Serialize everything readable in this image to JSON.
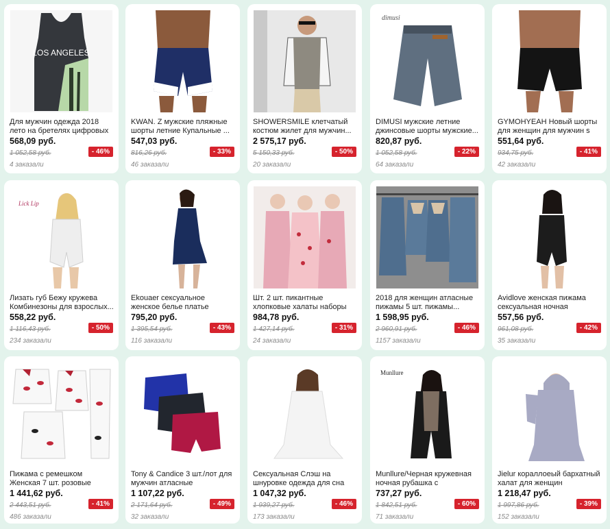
{
  "colors": {
    "background": "#e3f3ec",
    "discount_badge": "#d6232d",
    "card": "#ffffff"
  },
  "products": [
    {
      "title": "Для мужчин одежда 2018 лето на бретелях цифровых жилет ...",
      "price": "568,09 руб.",
      "old_price": "1 052,58 руб.",
      "discount": "- 46%",
      "orders": "4 заказали",
      "image_icon": "tank-top-image",
      "image_text": "LOS ANGELES"
    },
    {
      "title": "KWAN. Z мужские пляжные шорты летние Купальные ...",
      "price": "547,03 руб.",
      "old_price": "816,26 руб.",
      "discount": "- 33%",
      "orders": "46 заказали",
      "image_icon": "beach-shorts-image",
      "image_text": ""
    },
    {
      "title": "SHOWERSMILE клетчатый костюм жилет для мужчин...",
      "price": "2 575,17 руб.",
      "old_price": "5 150,33 руб.",
      "discount": "- 50%",
      "orders": "20 заказали",
      "image_icon": "vest-suit-image",
      "image_text": ""
    },
    {
      "title": "DIMUSI мужские летние джинсовые шорты мужские...",
      "price": "820,87 руб.",
      "old_price": "1 052,58 руб.",
      "discount": "- 22%",
      "orders": "64 заказали",
      "image_icon": "denim-shorts-image",
      "image_text": "dimusi"
    },
    {
      "title": "GYMOHYEAH Новый шорты для женщин для мужчин s Край ...",
      "price": "551,64 руб.",
      "old_price": "934,75 руб.",
      "discount": "- 41%",
      "orders": "42 заказали",
      "image_icon": "black-shorts-image",
      "image_text": ""
    },
    {
      "title": "Лизать губ Бежу кружева Комбинезоны для взрослых...",
      "price": "558,22 руб.",
      "old_price": "1 116,43 руб.",
      "discount": "- 50%",
      "orders": "234 заказали",
      "image_icon": "white-romper-image",
      "image_text": "Lick Lip"
    },
    {
      "title": "Ekouaer сексуальное женское белье платье пижамы для...",
      "price": "795,20 руб.",
      "old_price": "1 395,54 руб.",
      "discount": "- 43%",
      "orders": "116 заказали",
      "image_icon": "navy-nightdress-image",
      "image_text": ""
    },
    {
      "title": "Шт. 2 шт. пикантные хлопковые халаты наборы дл...",
      "price": "984,78 руб.",
      "old_price": "1 427,14 руб.",
      "discount": "- 31%",
      "orders": "24 заказали",
      "image_icon": "pink-robes-image",
      "image_text": ""
    },
    {
      "title": "2018 для женщин атласные пижамы 5 шт. пижамы...",
      "price": "1 598,95 руб.",
      "old_price": "2 960,91 руб.",
      "discount": "- 46%",
      "orders": "1157 заказали",
      "image_icon": "satin-pajama-set-image",
      "image_text": ""
    },
    {
      "title": "Avidlove женская пижама сексуальная ночная рубашка...",
      "price": "557,56 руб.",
      "old_price": "961,08 руб.",
      "discount": "- 42%",
      "orders": "35 заказали",
      "image_icon": "black-satin-romper-image",
      "image_text": ""
    },
    {
      "title": "Пижама с ремешком Женская 7 шт. розовые пижамы наборы...",
      "price": "1 441,62 руб.",
      "old_price": "2 443,51 руб.",
      "discount": "- 41%",
      "orders": "486 заказали",
      "image_icon": "lips-pajama-set-image",
      "image_text": ""
    },
    {
      "title": "Tony & Candice 3 шт./лот для мужчин атласные шелковые...",
      "price": "1 107,22 руб.",
      "old_price": "2 171,64 руб.",
      "discount": "- 49%",
      "orders": "32 заказали",
      "image_icon": "silk-boxers-image",
      "image_text": ""
    },
    {
      "title": "Сексуальная Слэш на шнуровке одежда для сна Ночное плать...",
      "price": "1 047,32 руб.",
      "old_price": "1 939,27 руб.",
      "discount": "- 46%",
      "orders": "173 заказали",
      "image_icon": "white-nightgown-image",
      "image_text": ""
    },
    {
      "title": "Munllure/Черная кружевная ночная рубашка с ресницами,...",
      "price": "737,27 руб.",
      "old_price": "1 842,51 руб.",
      "discount": "- 60%",
      "orders": "71 заказали",
      "image_icon": "black-lace-robe-image",
      "image_text": "Munllure"
    },
    {
      "title": "Jielur кораллоеый бархатный халат для женщин мультфиль...",
      "price": "1 218,47 руб.",
      "old_price": "1 997,86 руб.",
      "discount": "- 39%",
      "orders": "152 заказали",
      "image_icon": "plush-robe-image",
      "image_text": ""
    }
  ]
}
